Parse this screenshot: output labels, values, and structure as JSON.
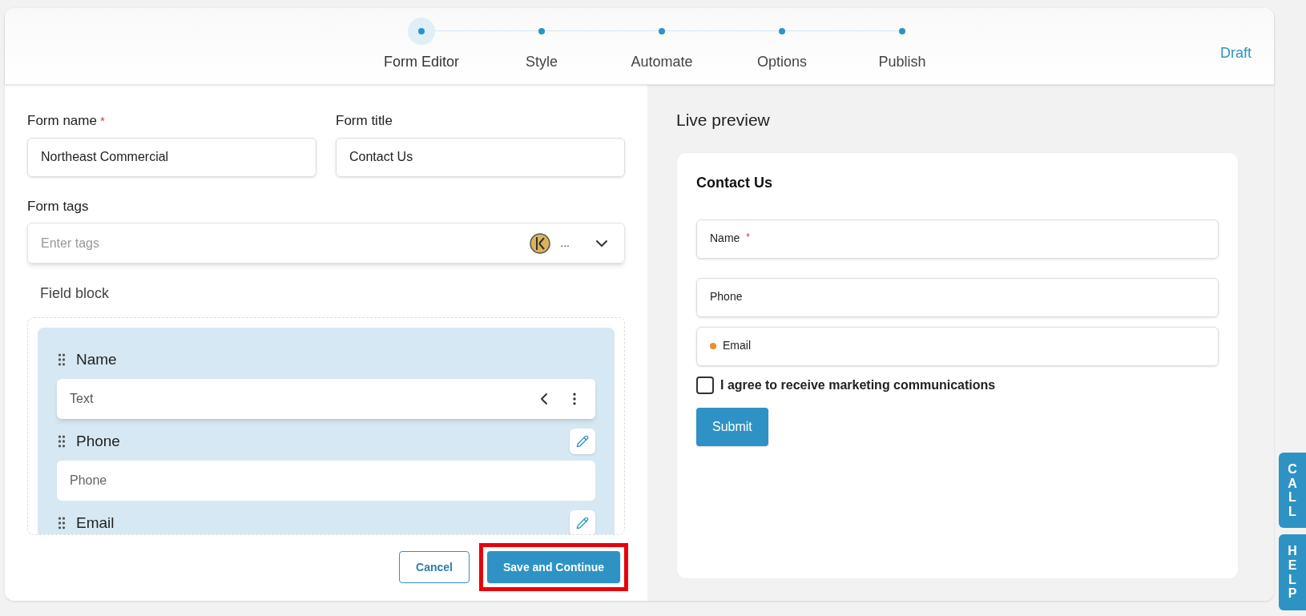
{
  "steps": [
    {
      "label": "Form Editor",
      "selected": true
    },
    {
      "label": "Style",
      "selected": false
    },
    {
      "label": "Automate",
      "selected": false
    },
    {
      "label": "Options",
      "selected": false
    },
    {
      "label": "Publish",
      "selected": false
    }
  ],
  "status": "Draft",
  "editor": {
    "form_name": {
      "label": "Form name",
      "required_mark": "*",
      "value": "Northeast Commercial"
    },
    "form_title": {
      "label": "Form title",
      "value": "Contact Us"
    },
    "form_tags": {
      "label": "Form tags",
      "placeholder": "Enter tags",
      "more": "..."
    },
    "field_block": {
      "title": "Field block",
      "fields": [
        {
          "name": "Name",
          "kind": "dropdown",
          "value": "Text",
          "editable": false
        },
        {
          "name": "Phone",
          "kind": "input",
          "placeholder": "Phone",
          "editable": true
        },
        {
          "name": "Email",
          "kind": "input",
          "editable": true
        }
      ]
    },
    "buttons": {
      "cancel": "Cancel",
      "save": "Save and Continue"
    }
  },
  "preview": {
    "title": "Live preview",
    "form_title": "Contact Us",
    "fields": [
      {
        "label": "Name",
        "required_mark": "*",
        "flagged": false
      },
      {
        "label": "Phone",
        "flagged": false
      },
      {
        "label": "Email",
        "flagged": true
      }
    ],
    "consent": {
      "label": "I agree to receive marketing communications",
      "checked": false
    },
    "submit": "Submit"
  },
  "side_tabs": [
    "CALL",
    "HELP"
  ]
}
